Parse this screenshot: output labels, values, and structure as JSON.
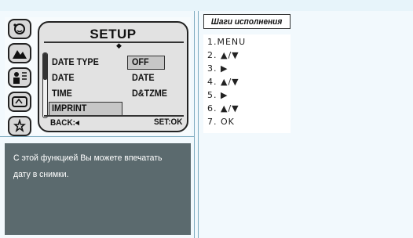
{
  "mode_icons": [
    {
      "name": "portrait-night-icon"
    },
    {
      "name": "landscape-icon"
    },
    {
      "name": "portrait-icon"
    },
    {
      "name": "scene-mode-icon"
    },
    {
      "name": "stars-icon"
    }
  ],
  "menu": {
    "title": "SETUP",
    "scroll_indicator": "◆",
    "rows": [
      {
        "label": "DATE TYPE",
        "value": "OFF"
      },
      {
        "label": "DATE",
        "value": "DATE"
      },
      {
        "label": "TIME",
        "value": "D&TZME"
      },
      {
        "label": "IMPRINT",
        "value": ""
      }
    ],
    "footer_left": "BACK:◂",
    "footer_right": "SET:OK"
  },
  "description": "С этой функцией Вы можете впечатать дату в снимки.",
  "steps": {
    "title": "Шаги исполнения",
    "items": [
      "1.MENU",
      "2. ▲/▼",
      "3. ▶",
      "4. ▲/▼",
      "5. ▶",
      "6. ▲/▼",
      "7. OK"
    ]
  }
}
